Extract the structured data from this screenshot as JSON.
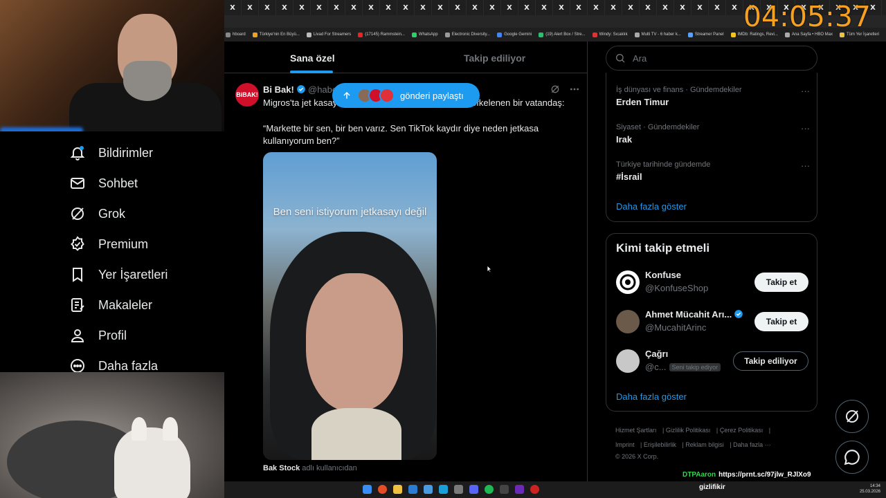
{
  "stream": {
    "timer": "04:05:37",
    "overlay_user": "DTPAaron",
    "overlay_link": "https://prnt.sc/97jlw_RJlXo9",
    "overlay_tag": "gizlifikir"
  },
  "browser": {
    "tab_glyph": "X",
    "bookmarks": [
      "hboard",
      "Türkiye'nin En Büyü...",
      "Livad For Streamers",
      "(17145) Rammstein...",
      "WhatsApp",
      "Electronic Diversity...",
      "Google Gemini",
      "(19) Alert Box / Stre...",
      "Windy: Sıcaklık",
      "Multi TV - 6 haber k...",
      "Streamer Panel",
      "IMDb: Ratings, Revi...",
      "Ana Sayfa • HBO Max",
      "Tüm Yer İşaretleri"
    ]
  },
  "leftnav": {
    "items": [
      {
        "label": "Bildirimler",
        "icon": "bell-icon"
      },
      {
        "label": "Sohbet",
        "icon": "mail-icon"
      },
      {
        "label": "Grok",
        "icon": "grok-icon"
      },
      {
        "label": "Premium",
        "icon": "premium-icon"
      },
      {
        "label": "Yer İşaretleri",
        "icon": "bookmark-icon"
      },
      {
        "label": "Makaleler",
        "icon": "article-icon"
      },
      {
        "label": "Profil",
        "icon": "person-icon"
      },
      {
        "label": "Daha fazla",
        "icon": "more-circle-icon"
      }
    ]
  },
  "feed": {
    "tab_active": "Sana özel",
    "tab_inactive": "Takip ediliyor",
    "share_pill": "gönderi paylaştı",
    "tweet": {
      "avatar_text": "BiBAK!",
      "name": "Bi Bak!",
      "handle": "@habe",
      "line1_start": "Migros'ta jet kasay",
      "line1_end": "öfkelenen bir vatandaş:",
      "body": "“Markette bir sen, bir ben varız. Sen TikTok kaydır diye neden jetkasa kullanıyorum ben?”",
      "media_caption": "Ben seni istiyorum jetkasayı değil",
      "source_name": "Bak Stock",
      "source_suffix": "adlı kullanıcıdan"
    }
  },
  "sidebar_right": {
    "search_placeholder": "Ara",
    "trends": [
      {
        "category": "İş dünyası ve finans · Gündemdekiler",
        "topic": "Erden Timur"
      },
      {
        "category": "Siyaset · Gündemdekiler",
        "topic": "Irak"
      },
      {
        "category": "Türkiye tarihinde gündemde",
        "topic": "#İsrail"
      }
    ],
    "show_more": "Daha fazla göster",
    "who_to_follow_title": "Kimi takip etmeli",
    "suggestions": [
      {
        "name": "Konfuse",
        "handle": "@KonfuseShop",
        "button": "Takip et",
        "verified": false
      },
      {
        "name": "Ahmet Mücahit Arı...",
        "handle": "@MucahitArinc",
        "button": "Takip et",
        "verified": true
      },
      {
        "name": "Çağrı",
        "handle": "@c...",
        "badge": "Seni takip ediyor",
        "button": "Takip ediliyor",
        "verified": false
      }
    ],
    "show_more_2": "Daha fazla göster",
    "footer": {
      "links_row1": [
        "Hizmet Şartları",
        "Gizlilik Politikası",
        "Çerez Politikası"
      ],
      "links_row2": [
        "Imprint",
        "Erişilebilirlik",
        "Reklam bilgisi",
        "Daha fazla ···"
      ],
      "copyright": "© 2026 X Corp."
    }
  },
  "taskbar": {
    "time": "14:34",
    "date": "25.03.2026"
  },
  "colors": {
    "accent": "#1d9bf0",
    "timer": "#f5a020",
    "background": "#000000"
  }
}
